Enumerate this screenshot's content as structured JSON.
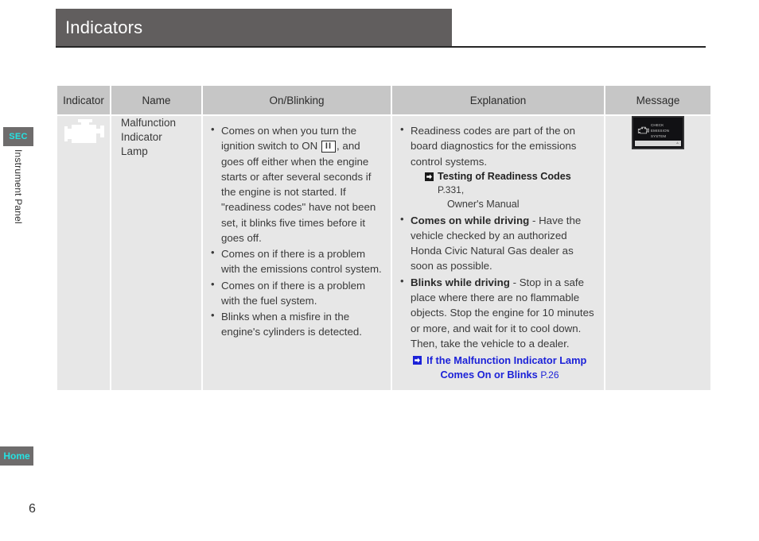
{
  "header": {
    "title": "Indicators"
  },
  "rail": {
    "section_tab": "SEC",
    "chapter_label": "Instrument Panel",
    "home_label": "Home",
    "page_number": "6"
  },
  "table": {
    "columns": [
      {
        "key": "indicator",
        "label": "Indicator"
      },
      {
        "key": "name",
        "label": "Name"
      },
      {
        "key": "onblinking",
        "label": "On/Blinking"
      },
      {
        "key": "explanation",
        "label": "Explanation"
      },
      {
        "key": "message",
        "label": "Message"
      }
    ],
    "rows": [
      {
        "indicator_icon": "check-engine-icon",
        "name": "Malfunction Indicator Lamp",
        "onblinking": [
          {
            "segments": [
              {
                "text": "Comes on when you turn the ignition switch to ON "
              },
              {
                "type": "key",
                "text": "II"
              },
              {
                "text": ", and goes off either when the engine starts or after several seconds if the engine is not started. If \"readiness codes\" have not been set, it blinks five times before it goes off."
              }
            ]
          },
          {
            "segments": [
              {
                "text": "Comes on if there is a problem with the emissions control system."
              }
            ]
          },
          {
            "segments": [
              {
                "text": "Comes on if there is a problem with the fuel system."
              }
            ]
          },
          {
            "segments": [
              {
                "text": "Blinks when a misfire in the engine's cylinders is detected."
              }
            ]
          }
        ],
        "explanation": {
          "bullets": [
            {
              "text": "Readiness codes are part of the on board diagnostics for the emissions control systems.",
              "reference": {
                "icon": "jump-arrow-icon",
                "title": "Testing of Readiness Codes",
                "page": "P.331,",
                "subtitle": "Owner's Manual"
              }
            },
            {
              "lead": "Comes on while driving",
              "text": " - Have the vehicle checked by an authorized Honda Civic Natural Gas dealer as soon as possible."
            },
            {
              "lead": "Blinks while driving",
              "text": " - Stop in a safe place where there are no flammable objects. Stop the engine for 10 minutes or more, and wait for it to cool down. Then, take the vehicle to a dealer."
            }
          ],
          "blue_reference": {
            "icon": "jump-arrow-icon",
            "title": "If the Malfunction Indicator Lamp Comes On or Blinks",
            "page": "P.26"
          }
        },
        "message": {
          "display_line1": "CHECK EMISSION",
          "display_line2": "SYSTEM",
          "icon": "check-engine-icon"
        }
      }
    ]
  },
  "colors": {
    "header_bar": "#615e5e",
    "table_header": "#c6c6c6",
    "cell_light": "#e7e7e7",
    "cell_dark": "#615e5e",
    "accent_cyan": "#25e3e3",
    "link_blue": "#1c22d8"
  }
}
